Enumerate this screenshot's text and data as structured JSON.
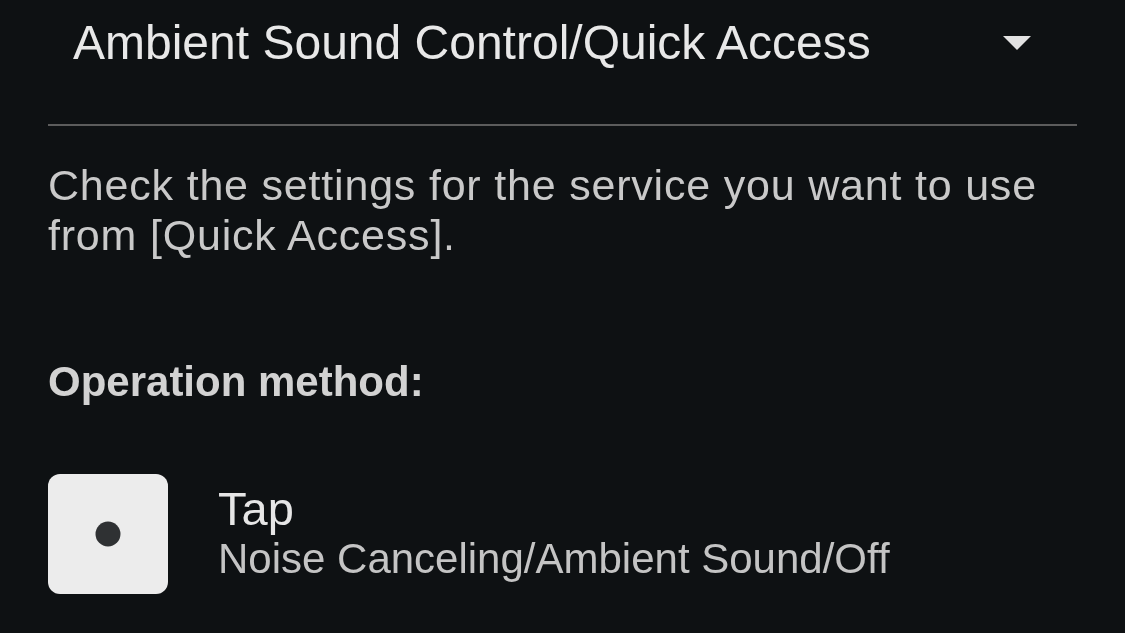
{
  "dropdown": {
    "value": "Ambient Sound Control/Quick Access"
  },
  "description": "Check the settings for the service you want to use from [Quick Access].",
  "section_label": "Operation method:",
  "operations": [
    {
      "kind": "tap",
      "title": "Tap",
      "subtitle": "Noise Canceling/Ambient Sound/Off"
    }
  ]
}
